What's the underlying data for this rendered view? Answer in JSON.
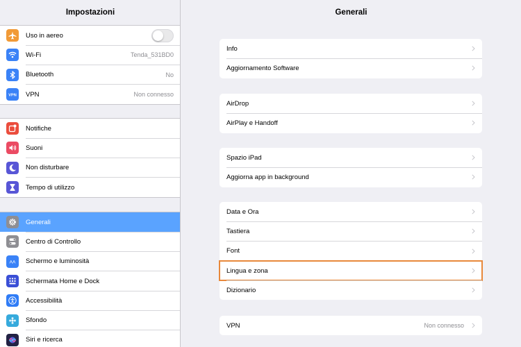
{
  "sidebar": {
    "title": "Impostazioni",
    "groups": [
      [
        {
          "label": "Uso in aereo",
          "icon": "airplane-icon",
          "color": "#f19a37",
          "toggle": false
        },
        {
          "label": "Wi-Fi",
          "icon": "wifi-icon",
          "color": "#3a82f7",
          "value": "Tenda_531BD0"
        },
        {
          "label": "Bluetooth",
          "icon": "bluetooth-icon",
          "color": "#3a82f7",
          "value": "No"
        },
        {
          "label": "VPN",
          "icon": "vpn-icon",
          "color": "#3a82f7",
          "value": "Non connesso"
        }
      ],
      [
        {
          "label": "Notifiche",
          "icon": "notifications-icon",
          "color": "#eb4d3d"
        },
        {
          "label": "Suoni",
          "icon": "sounds-icon",
          "color": "#eb4b63"
        },
        {
          "label": "Non disturbare",
          "icon": "moon-icon",
          "color": "#5856d6"
        },
        {
          "label": "Tempo di utilizzo",
          "icon": "hourglass-icon",
          "color": "#5856d6"
        }
      ],
      [
        {
          "label": "Generali",
          "icon": "gear-icon",
          "color": "#8e8e93",
          "selected": true
        },
        {
          "label": "Centro di Controllo",
          "icon": "control-center-icon",
          "color": "#8e8e93"
        },
        {
          "label": "Schermo e luminosità",
          "icon": "display-icon",
          "color": "#3a82f7"
        },
        {
          "label": "Schermata Home e Dock",
          "icon": "home-dock-icon",
          "color": "#3a4fd6"
        },
        {
          "label": "Accessibilità",
          "icon": "accessibility-icon",
          "color": "#2f7cf6"
        },
        {
          "label": "Sfondo",
          "icon": "wallpaper-icon",
          "color": "#36aadc"
        },
        {
          "label": "Siri e ricerca",
          "icon": "siri-icon",
          "color": "#222244"
        }
      ]
    ]
  },
  "main": {
    "title": "Generali",
    "groups": [
      [
        {
          "label": "Info"
        },
        {
          "label": "Aggiornamento Software"
        }
      ],
      [
        {
          "label": "AirDrop"
        },
        {
          "label": "AirPlay e Handoff"
        }
      ],
      [
        {
          "label": "Spazio iPad"
        },
        {
          "label": "Aggiorna app in background"
        }
      ],
      [
        {
          "label": "Data e Ora"
        },
        {
          "label": "Tastiera"
        },
        {
          "label": "Font"
        },
        {
          "label": "Lingua e zona",
          "highlighted": true
        },
        {
          "label": "Dizionario"
        }
      ],
      [
        {
          "label": "VPN",
          "value": "Non connesso"
        }
      ]
    ],
    "highlight_color": "#e8883a"
  },
  "colors": {
    "selection": "#5aa3ff",
    "background": "#efeff4",
    "secondary_text": "#8e8e93"
  }
}
